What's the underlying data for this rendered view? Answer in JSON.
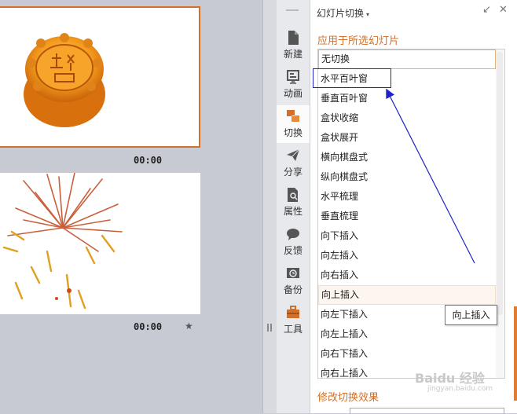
{
  "thumbnails": {
    "slide1_time": "00:00",
    "slide2_time": "00:00",
    "slide2_star": "★"
  },
  "rail": {
    "items": [
      {
        "label": "新建",
        "icon": "new-file-icon"
      },
      {
        "label": "动画",
        "icon": "animation-icon"
      },
      {
        "label": "切换",
        "icon": "transition-icon"
      },
      {
        "label": "分享",
        "icon": "share-icon"
      },
      {
        "label": "属性",
        "icon": "properties-icon"
      },
      {
        "label": "反馈",
        "icon": "feedback-icon"
      },
      {
        "label": "备份",
        "icon": "backup-icon"
      },
      {
        "label": "工具",
        "icon": "toolbox-icon"
      }
    ],
    "active": "切换"
  },
  "pane": {
    "title": "幻灯片切换",
    "title_caret": "▾",
    "restore_glyph": "↙",
    "close_glyph": "✕",
    "apply_section": "应用于所选幻灯片",
    "modify_section": "修改切换效果",
    "transitions": [
      "无切换",
      "水平百叶窗",
      "垂直百叶窗",
      "盒状收缩",
      "盒状展开",
      "横向棋盘式",
      "纵向棋盘式",
      "水平梳理",
      "垂直梳理",
      "向下插入",
      "向左插入",
      "向右插入",
      "向上插入",
      "向左下插入",
      "向左上插入",
      "向右下插入",
      "向右上插入"
    ],
    "selected": "无切换",
    "hovered": "向上插入",
    "tooltip": "向上插入"
  },
  "watermark": {
    "text": "Baidu 经验",
    "url": "jingyan.baidu.com"
  },
  "colors": {
    "accent": "#d2702b",
    "annotation": "#2222cc"
  }
}
